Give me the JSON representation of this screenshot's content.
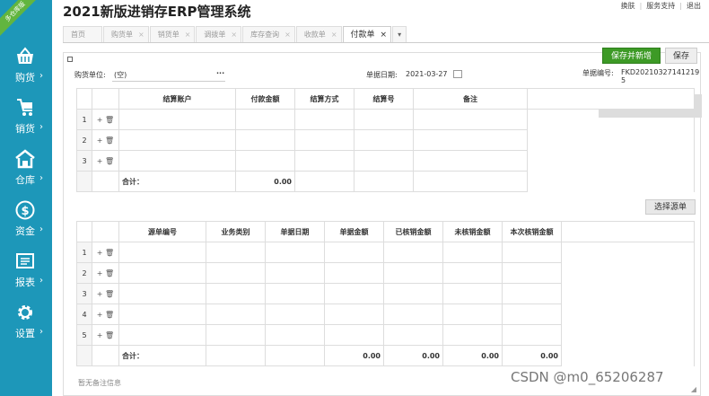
{
  "sidebar": {
    "badge": "多仓库版",
    "items": [
      {
        "label": "购货",
        "icon": "basket-icon"
      },
      {
        "label": "销货",
        "icon": "cart-icon"
      },
      {
        "label": "仓库",
        "icon": "warehouse-icon"
      },
      {
        "label": "资金",
        "icon": "money-icon"
      },
      {
        "label": "报表",
        "icon": "report-icon"
      },
      {
        "label": "设置",
        "icon": "gear-icon"
      }
    ]
  },
  "header": {
    "title": "2021新版进销存ERP管理系统",
    "links": [
      "换肤",
      "服务支持",
      "退出"
    ]
  },
  "tabs": [
    {
      "label": "首页",
      "closable": false
    },
    {
      "label": "购货单",
      "closable": true
    },
    {
      "label": "销货单",
      "closable": true
    },
    {
      "label": "调拨单",
      "closable": true
    },
    {
      "label": "库存查询",
      "closable": true
    },
    {
      "label": "收款单",
      "closable": true
    },
    {
      "label": "付款单",
      "closable": true,
      "active": true
    }
  ],
  "form": {
    "supplier_label": "购货单位:",
    "supplier_value": "(空)",
    "supplier_more": "···",
    "date_label": "单据日期:",
    "date_value": "2021-03-27",
    "number_label": "单据编号:",
    "number_value": "FKD20210327141219 5",
    "save_new_label": "保存并新增",
    "save_label": "保存",
    "select_source_label": "选择源单",
    "note": "暂无备注信息"
  },
  "table1": {
    "headers": [
      "结算账户",
      "付款金额",
      "结算方式",
      "结算号",
      "备注"
    ],
    "rows": [
      "1",
      "2",
      "3"
    ],
    "total_label": "合计：",
    "total_amount": "0.00"
  },
  "table2": {
    "headers": [
      "源单编号",
      "业务类别",
      "单据日期",
      "单据金额",
      "已核销金额",
      "未核销金额",
      "本次核销金额"
    ],
    "rows": [
      "1",
      "2",
      "3",
      "4",
      "5"
    ],
    "total_label": "合计：",
    "totals": [
      "0.00",
      "0.00",
      "0.00",
      "0.00"
    ]
  },
  "watermark": "CSDN @m0_65206287"
}
